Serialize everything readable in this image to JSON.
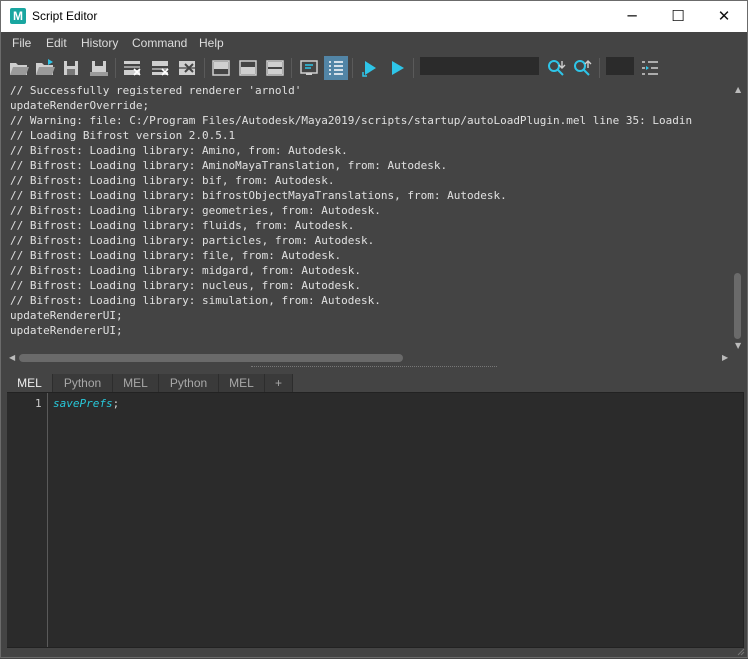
{
  "window": {
    "title": "Script Editor",
    "app_icon": "M",
    "controls": {
      "minimize": "─",
      "maximize": "☐",
      "close": "✕"
    }
  },
  "menubar": {
    "items": [
      {
        "label": "File"
      },
      {
        "label": "Edit"
      },
      {
        "label": "History"
      },
      {
        "label": "Command"
      },
      {
        "label": "Help"
      }
    ]
  },
  "toolbar": {
    "buttons": [
      "open-script-icon",
      "source-script-icon",
      "save-script-icon",
      "save-script-to-shelf-icon",
      "clear-history-icon",
      "clear-input-icon",
      "clear-all-icon",
      "show-history-only-icon",
      "show-input-only-icon",
      "show-both-icon",
      "echo-all-commands-icon",
      "show-line-numbers-icon",
      "execute-all-icon",
      "execute-icon",
      "search-down-icon",
      "search-up-icon",
      "goto-line-icon"
    ],
    "search_value": "",
    "goto_value": "",
    "active_button": "show-line-numbers-icon",
    "accent_color": "#5285a6",
    "icon_blue": "#2ec5e8"
  },
  "history": {
    "lines": [
      "// Successfully registered renderer 'arnold'",
      "updateRenderOverride;",
      "// Warning: file: C:/Program Files/Autodesk/Maya2019/scripts/startup/autoLoadPlugin.mel line 35: Loadin",
      "// Loading Bifrost version 2.0.5.1",
      "// Bifrost: Loading library: Amino, from: Autodesk.",
      "// Bifrost: Loading library: AminoMayaTranslation, from: Autodesk.",
      "// Bifrost: Loading library: bif, from: Autodesk.",
      "// Bifrost: Loading library: bifrostObjectMayaTranslations, from: Autodesk.",
      "// Bifrost: Loading library: geometries, from: Autodesk.",
      "// Bifrost: Loading library: fluids, from: Autodesk.",
      "// Bifrost: Loading library: particles, from: Autodesk.",
      "// Bifrost: Loading library: file, from: Autodesk.",
      "// Bifrost: Loading library: midgard, from: Autodesk.",
      "// Bifrost: Loading library: nucleus, from: Autodesk.",
      "// Bifrost: Loading library: simulation, from: Autodesk.",
      "updateRendererUI;",
      "updateRendererUI;"
    ]
  },
  "tabs": [
    {
      "label": "MEL",
      "active": true
    },
    {
      "label": "Python",
      "active": false
    },
    {
      "label": "MEL",
      "active": false
    },
    {
      "label": "Python",
      "active": false
    },
    {
      "label": "MEL",
      "active": false
    },
    {
      "label": "+",
      "active": false
    }
  ],
  "editor": {
    "line_number": "1",
    "code": "savePrefs",
    "terminator": ";",
    "code_color": "#28c7d8"
  }
}
